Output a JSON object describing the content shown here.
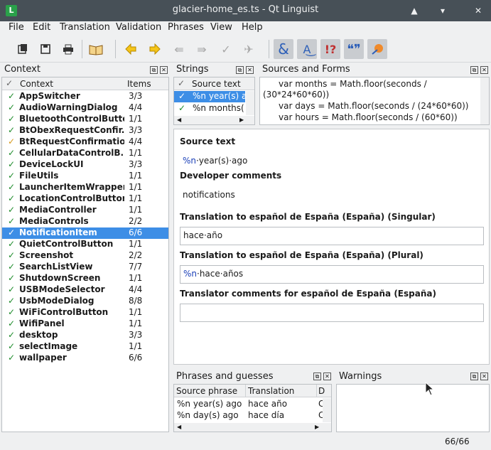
{
  "window": {
    "title": "glacier-home_es.ts - Qt Linguist"
  },
  "menu": [
    "File",
    "Edit",
    "Translation",
    "Validation",
    "Phrases",
    "View",
    "Help"
  ],
  "menu_accel": [
    "F",
    "E",
    "T",
    "V",
    "P",
    "V",
    "H"
  ],
  "context_panel": {
    "title": "Context",
    "col_context": "Context",
    "col_items": "Items",
    "rows": [
      {
        "name": "AppSwitcher",
        "items": "3/3",
        "state": "done"
      },
      {
        "name": "AudioWarningDialog",
        "items": "4/4",
        "state": "done"
      },
      {
        "name": "BluetoothControlButton",
        "items": "1/1",
        "state": "done"
      },
      {
        "name": "BtObexRequestConfir...",
        "items": "3/3",
        "state": "done"
      },
      {
        "name": "BtRequestConfirmatio...",
        "items": "4/4",
        "state": "warn"
      },
      {
        "name": "CellularDataControlB...",
        "items": "1/1",
        "state": "done"
      },
      {
        "name": "DeviceLockUI",
        "items": "3/3",
        "state": "done"
      },
      {
        "name": "FileUtils",
        "items": "1/1",
        "state": "done"
      },
      {
        "name": "LauncherItemWrapper",
        "items": "1/1",
        "state": "done"
      },
      {
        "name": "LocationControlButton",
        "items": "1/1",
        "state": "done"
      },
      {
        "name": "MediaController",
        "items": "1/1",
        "state": "done"
      },
      {
        "name": "MediaControls",
        "items": "2/2",
        "state": "done"
      },
      {
        "name": "NotificationItem",
        "items": "6/6",
        "state": "done"
      },
      {
        "name": "QuietControlButton",
        "items": "1/1",
        "state": "done"
      },
      {
        "name": "Screenshot",
        "items": "2/2",
        "state": "done"
      },
      {
        "name": "SearchListView",
        "items": "7/7",
        "state": "done"
      },
      {
        "name": "ShutdownScreen",
        "items": "1/1",
        "state": "done"
      },
      {
        "name": "USBModeSelector",
        "items": "4/4",
        "state": "done"
      },
      {
        "name": "UsbModeDialog",
        "items": "8/8",
        "state": "done"
      },
      {
        "name": "WiFiControlButton",
        "items": "1/1",
        "state": "done"
      },
      {
        "name": "WifiPanel",
        "items": "1/1",
        "state": "done"
      },
      {
        "name": "desktop",
        "items": "3/3",
        "state": "done"
      },
      {
        "name": "selectImage",
        "items": "1/1",
        "state": "done"
      },
      {
        "name": "wallpaper",
        "items": "6/6",
        "state": "done"
      }
    ],
    "selected_index": 12
  },
  "strings_panel": {
    "title": "Strings",
    "col_source": "Source text",
    "rows": [
      "%n year(s) a",
      "%n months("
    ]
  },
  "sources_panel": {
    "title": "Sources and Forms",
    "lines": [
      "var months = Math.floor(seconds /",
      "(30*24*60*60))",
      "var days = Math.floor(seconds / (24*60*60))",
      "var hours = Math.floor(seconds / (60*60))"
    ]
  },
  "editor": {
    "source_label": "Source text",
    "source_prefix": "%n",
    "source_rest": "·year(s)·ago",
    "dev_comments_label": "Developer comments",
    "dev_comments": "notifications",
    "singular_label": "Translation to español de España (España) (Singular)",
    "singular_value": "hace·año",
    "plural_label": "Translation to español de España (España) (Plural)",
    "plural_prefix": "%n",
    "plural_rest": "·hace·años",
    "comments_label": "Translator comments for español de España (España)",
    "comments_value": ""
  },
  "phrases_panel": {
    "title": "Phrases and guesses",
    "col_source": "Source phrase",
    "col_translation": "Translation",
    "col_extra": "D",
    "rows": [
      {
        "source": "%n year(s) ago",
        "translation": "hace año",
        "extra": "C"
      },
      {
        "source": "%n day(s) ago",
        "translation": "hace día",
        "extra": "C"
      }
    ]
  },
  "warnings_panel": {
    "title": "Warnings"
  },
  "status": {
    "count": "66/66"
  },
  "colors": {
    "check_green": "#1e8c2b",
    "check_warn": "#d69a1e",
    "selection": "#3d8ee6",
    "titlebar": "#475057"
  }
}
